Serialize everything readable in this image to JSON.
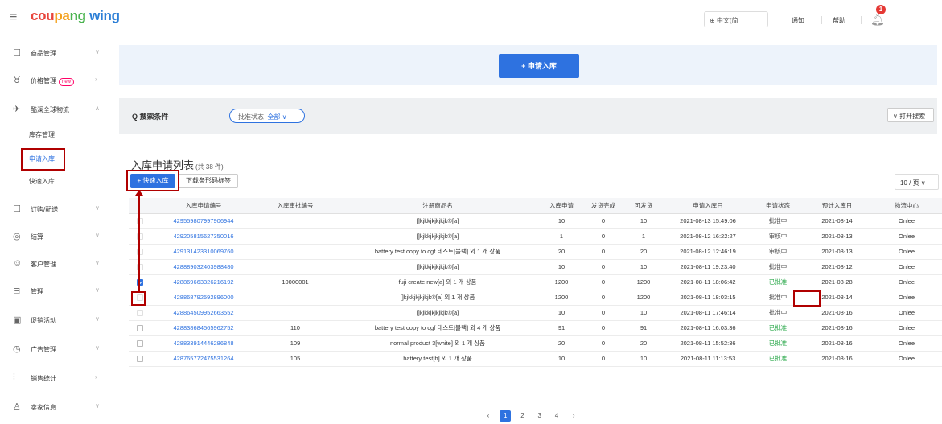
{
  "brand": {
    "part1": "cou",
    "part2": "pa",
    "part3": "ng",
    "part4": " wing"
  },
  "header": {
    "lang": "⊕ 中文(简",
    "link_notice": "通知",
    "link_help": "帮助",
    "bell_count": "1"
  },
  "sidebar": {
    "items": [
      {
        "icon": "☐",
        "label": "商品管理",
        "arrow": "∨"
      },
      {
        "icon": "♉",
        "label": "价格管理",
        "badge": "new",
        "arrow": "›"
      },
      {
        "icon": "✈",
        "label": "酷澜全球物流",
        "arrow": "∧"
      },
      {
        "icon": "☐",
        "label": "订购/配送",
        "arrow": "∨"
      },
      {
        "icon": "◎",
        "label": "结算",
        "arrow": "∨"
      },
      {
        "icon": "☺",
        "label": "客户管理",
        "arrow": "∨"
      },
      {
        "icon": "⊟",
        "label": "管理",
        "arrow": "∨"
      },
      {
        "icon": "▣",
        "label": "促销活动",
        "arrow": "∨"
      },
      {
        "icon": "◷",
        "label": "广告管理",
        "arrow": "∨"
      },
      {
        "icon": "⫶",
        "label": "销售统计",
        "arrow": "›"
      },
      {
        "icon": "♙",
        "label": "卖家信息",
        "arrow": "∨"
      }
    ],
    "sub": [
      "库存管理",
      "申请入库",
      "快速入库"
    ]
  },
  "banner": {
    "apply_button": "+ 申请入库"
  },
  "search": {
    "label": "Q 搜索条件",
    "pill_prefix": "批准状态",
    "pill_value": "全部 ∨",
    "open_button": "∨ 打开搜索"
  },
  "list": {
    "title": "入库申请列表",
    "count": "(共 38 件)",
    "quick_button": "+ 快速入库",
    "barcode_button": "下载条形码标签",
    "page_size": "10 / 页  ∨"
  },
  "table": {
    "columns": [
      "",
      "入库申请编号",
      "入库审批编号",
      "注册商品名",
      "入库申请",
      "发货完成",
      "可发货",
      "申请入库日",
      "申请状态",
      "预计入库日",
      "物流中心"
    ],
    "rows": [
      {
        "cb": "faint",
        "no": "429559807997906944",
        "approval": "",
        "name": "[]kjkkjkjkjkjk®[a]",
        "req": "10",
        "done": "0",
        "avail": "10",
        "date": "2021-08-13 15:49:06",
        "status": "批准中",
        "status_type": "review",
        "eta": "2021-08-14",
        "center": "Onlee"
      },
      {
        "cb": "faint",
        "no": "429205815627350016",
        "approval": "",
        "name": "[]kjkkjkjkjkjk®[a]",
        "req": "1",
        "done": "0",
        "avail": "1",
        "date": "2021-08-12 16:22:27",
        "status": "审核中",
        "status_type": "review",
        "eta": "2021-08-13",
        "center": "Onlee"
      },
      {
        "cb": "faint",
        "no": "429131423310069760",
        "approval": "",
        "name": "battery test copy to cgf 테스트[블랙] 외 1 개 상품",
        "req": "20",
        "done": "0",
        "avail": "20",
        "date": "2021-08-12 12:46:19",
        "status": "审核中",
        "status_type": "review",
        "eta": "2021-08-13",
        "center": "Onlee"
      },
      {
        "cb": "faint",
        "no": "428889032403988480",
        "approval": "",
        "name": "[]kjkkjkjkjkjk®[a]",
        "req": "10",
        "done": "0",
        "avail": "10",
        "date": "2021-08-11 19:23:40",
        "status": "批准中",
        "status_type": "review",
        "eta": "2021-08-12",
        "center": "Onlee"
      },
      {
        "cb": "checked",
        "no": "428869663326216192",
        "approval": "10000001",
        "name": "fuji create new[a] 외 1 개 상품",
        "req": "1200",
        "done": "0",
        "avail": "1200",
        "date": "2021-08-11 18:06:42",
        "status": "已批准",
        "status_type": "approved",
        "eta": "2021-08-28",
        "center": "Onlee"
      },
      {
        "cb": "faint",
        "no": "428868792592896000",
        "approval": "",
        "name": "[]kjkkjkjkjkjk®[a] 외 1 개 상품",
        "req": "1200",
        "done": "0",
        "avail": "1200",
        "date": "2021-08-11 18:03:15",
        "status": "批准中",
        "status_type": "review",
        "eta": "2021-08-14",
        "center": "Onlee"
      },
      {
        "cb": "faint",
        "no": "428864509952663552",
        "approval": "",
        "name": "[]kjkkjkjkjkjk®[a]",
        "req": "10",
        "done": "0",
        "avail": "10",
        "date": "2021-08-11 17:46:14",
        "status": "批准中",
        "status_type": "review",
        "eta": "2021-08-16",
        "center": "Onlee"
      },
      {
        "cb": "normal",
        "no": "428838684565962752",
        "approval": "110",
        "name": "battery test copy to cgf 테스트[블랙] 외 4 개 상품",
        "req": "91",
        "done": "0",
        "avail": "91",
        "date": "2021-08-11 16:03:36",
        "status": "已批准",
        "status_type": "approved",
        "eta": "2021-08-16",
        "center": "Onlee"
      },
      {
        "cb": "normal",
        "no": "428833914446286848",
        "approval": "109",
        "name": "normal product 3[white] 외 1 개 상품",
        "req": "20",
        "done": "0",
        "avail": "20",
        "date": "2021-08-11 15:52:36",
        "status": "已批准",
        "status_type": "approved",
        "eta": "2021-08-16",
        "center": "Onlee"
      },
      {
        "cb": "normal",
        "no": "428765772475531264",
        "approval": "105",
        "name": "battery test[b] 외 1 개 상품",
        "req": "10",
        "done": "0",
        "avail": "10",
        "date": "2021-08-11 11:13:53",
        "status": "已批准",
        "status_type": "approved",
        "eta": "2021-08-16",
        "center": "Onlee"
      }
    ]
  },
  "pager": {
    "prev": "‹",
    "pages": [
      "1",
      "2",
      "3",
      "4"
    ],
    "next": "›"
  },
  "colors": {
    "accent": "#2e72e0",
    "approved": "#2aa84a",
    "highlight": "#b00000"
  }
}
